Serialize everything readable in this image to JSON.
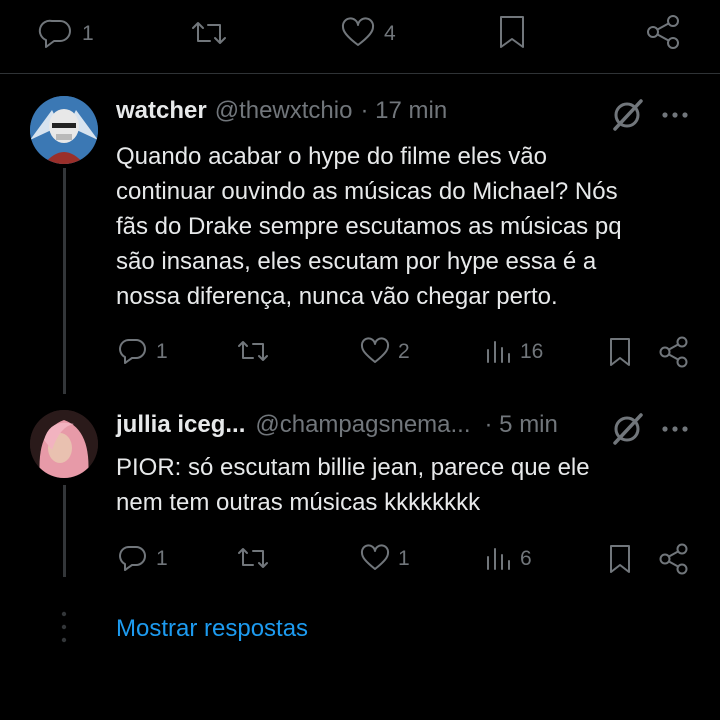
{
  "top_actions": {
    "reply_count": "1",
    "like_count": "4"
  },
  "posts": [
    {
      "display_name": "watcher",
      "handle": "@thewxtchio",
      "time": "· 17 min",
      "text": "Quando acabar o hype do filme eles vão\ncontinuar ouvindo as músicas do Michael? Nós\nfãs do Drake sempre escutamos as músicas pq\nsão insanas, eles escutam por hype essa é a\nnossa diferença, nunca vão chegar perto.",
      "reply_count": "1",
      "like_count": "2",
      "views_count": "16"
    },
    {
      "display_name": "jullia iceg...",
      "handle": "@champagsnema...",
      "time": "· 5 min",
      "text": "PIOR: só escutam billie jean, parece que ele\nnem tem outras músicas kkkkkkkk",
      "reply_count": "1",
      "like_count": "1",
      "views_count": "6"
    }
  ],
  "show_replies_label": "Mostrar respostas",
  "colors": {
    "background": "#000000",
    "text": "#e7e9ea",
    "muted": "#71767b",
    "link": "#1d9bf0",
    "divider": "#2f3336"
  }
}
